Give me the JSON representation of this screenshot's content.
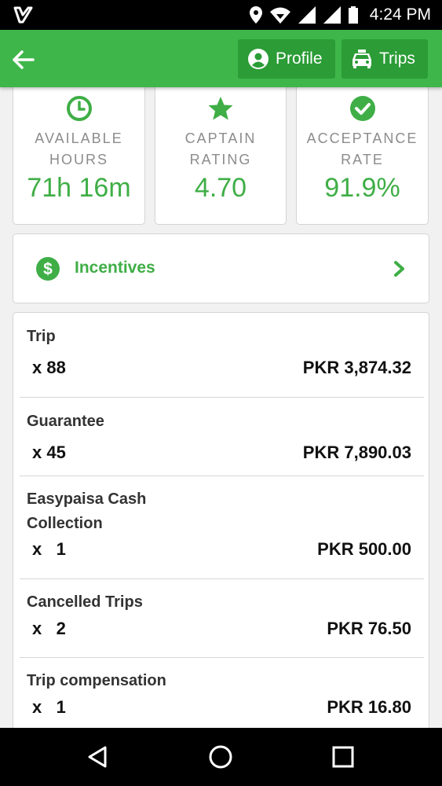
{
  "status_bar": {
    "time": "4:24 PM",
    "icons": [
      "app-logo-icon",
      "location-icon",
      "wifi-icon",
      "signal-icon",
      "signal-icon",
      "battery-icon"
    ]
  },
  "header": {
    "back_icon": "arrow-left-icon",
    "profile_label": "Profile",
    "trips_label": "Trips",
    "accent": "#3fb64a"
  },
  "stats": [
    {
      "icon": "clock-icon",
      "label_line1": "AVAILABLE",
      "label_line2": "HOURS",
      "value": "71h 16m"
    },
    {
      "icon": "star-icon",
      "label_line1": "CAPTAIN",
      "label_line2": "RATING",
      "value": "4.70"
    },
    {
      "icon": "check-circle-icon",
      "label_line1": "ACCEPTANCE",
      "label_line2": "RATE",
      "value": "91.9%"
    }
  ],
  "incentives": {
    "icon": "dollar-circle-icon",
    "label": "Incentives"
  },
  "breakdown": [
    {
      "title": "Trip",
      "qty": "x 88",
      "amount": "PKR 3,874.32"
    },
    {
      "title": "Guarantee",
      "qty": "x 45",
      "amount": "PKR 7,890.03"
    },
    {
      "title_line1": "Easypaisa Cash",
      "title_line2": "Collection",
      "qty": "x   1",
      "amount": "PKR 500.00"
    },
    {
      "title": "Cancelled Trips",
      "qty": "x   2",
      "amount": "PKR 76.50"
    },
    {
      "title": "Trip compensation",
      "qty": "x   1",
      "amount": "PKR 16.80"
    }
  ],
  "nav_bar": {
    "icons": [
      "back-triangle-icon",
      "home-circle-icon",
      "recents-square-icon"
    ]
  }
}
